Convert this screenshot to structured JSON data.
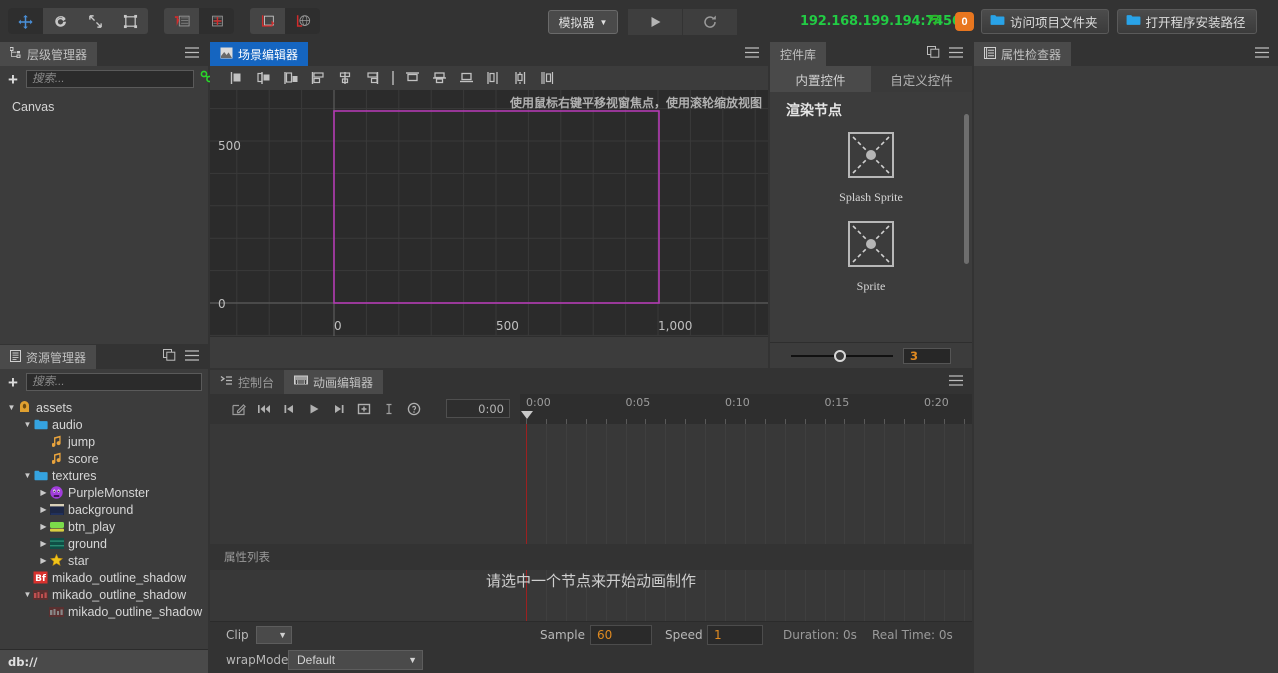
{
  "toolbar": {
    "tools": [
      {
        "name": "move-tool",
        "icon": "move-arrows",
        "selected": true
      },
      {
        "name": "rotate-tool",
        "icon": "rotate",
        "selected": false
      },
      {
        "name": "scale-tool",
        "icon": "scale",
        "selected": false
      },
      {
        "name": "rect-tool",
        "icon": "rect-transform",
        "selected": false
      }
    ],
    "pivot_tools": [
      {
        "name": "pivot-tool",
        "icon": "pivot",
        "selected": false
      },
      {
        "name": "center-tool",
        "icon": "center",
        "selected": true
      }
    ],
    "coord_tools": [
      {
        "name": "local-coord-tool",
        "icon": "local-axis",
        "selected": false
      },
      {
        "name": "global-coord-tool",
        "icon": "global-axis",
        "selected": true
      }
    ],
    "simulator_label": "模拟器",
    "play_label": "play",
    "refresh_label": "refresh",
    "ip_address": "192.168.199.194:7456",
    "wifi_icon": "wifi-icon",
    "badge_count": "0",
    "open_project_folder": "访问项目文件夹",
    "open_install_path": "打开程序安装路径"
  },
  "hierarchy": {
    "tab_title": "层级管理器",
    "tab_icon": "hierarchy-icon",
    "menu_icon": "hamburger-icon",
    "add_label": "+",
    "search_placeholder": "搜索...",
    "link_icon": "link-icon",
    "nodes": [
      {
        "label": "Canvas"
      }
    ]
  },
  "assets": {
    "tab_title": "资源管理器",
    "tab_icon": "assets-icon",
    "copy_icon": "copy-icon",
    "menu_icon": "hamburger-icon",
    "add_label": "+",
    "search_placeholder": "搜索...",
    "db_path": "db://",
    "tree": [
      {
        "label": "assets",
        "depth": 0,
        "arrow": "down",
        "icon": "assets-root",
        "icon_color": "#e0a030"
      },
      {
        "label": "audio",
        "depth": 1,
        "arrow": "down",
        "icon": "folder",
        "icon_color": "#35a3e0"
      },
      {
        "label": "jump",
        "depth": 2,
        "arrow": "none",
        "icon": "audio-note",
        "icon_color": "#e8a33d"
      },
      {
        "label": "score",
        "depth": 2,
        "arrow": "none",
        "icon": "audio-note",
        "icon_color": "#e8a33d"
      },
      {
        "label": "textures",
        "depth": 1,
        "arrow": "down",
        "icon": "folder",
        "icon_color": "#35a3e0"
      },
      {
        "label": "PurpleMonster",
        "depth": 2,
        "arrow": "right",
        "icon": "sprite-purple",
        "icon_color": "#a13ddb"
      },
      {
        "label": "background",
        "depth": 2,
        "arrow": "right",
        "icon": "sprite-bg",
        "icon_color": "#1d2745"
      },
      {
        "label": "btn_play",
        "depth": 2,
        "arrow": "right",
        "icon": "sprite-btn",
        "icon_color": "#7bdb4a"
      },
      {
        "label": "ground",
        "depth": 2,
        "arrow": "right",
        "icon": "sprite-ground",
        "icon_color": "#0f4f46"
      },
      {
        "label": "star",
        "depth": 2,
        "arrow": "right",
        "icon": "sprite-star",
        "icon_color": "#f0c419"
      },
      {
        "label": "mikado_outline_shadow",
        "depth": 1,
        "arrow": "none",
        "icon": "bitmap-font",
        "icon_color": "#d8322e"
      },
      {
        "label": "mikado_outline_shadow",
        "depth": 1,
        "arrow": "down",
        "icon": "font-atlas",
        "icon_color": "#c05050"
      },
      {
        "label": "mikado_outline_shadow",
        "depth": 2,
        "arrow": "none",
        "icon": "font-atlas",
        "icon_color": "#888888"
      }
    ]
  },
  "scene": {
    "tab_title": "场景编辑器",
    "tab_icon": "scene-icon",
    "menu_icon": "hamburger-icon",
    "align_tools": [
      "align-left",
      "align-center-h",
      "align-right",
      "align-box-left",
      "align-box-center",
      "align-box-right",
      "separator",
      "align-top",
      "align-middle",
      "align-bottom",
      "dist-h-left",
      "dist-h-center",
      "dist-h-right"
    ],
    "hint": "使用鼠标右键平移视窗焦点，使用滚轮缩放视图",
    "axis_y_labels": [
      "500",
      "0"
    ],
    "axis_x_labels": [
      "0",
      "500",
      "1,000"
    ],
    "canvas_rect_color": "#b23ab2"
  },
  "widgets": {
    "tab_title": "控件库",
    "copy_icon": "copy-icon",
    "menu_icon": "hamburger-icon",
    "tabs": [
      {
        "label": "内置控件",
        "active": true
      },
      {
        "label": "自定义控件",
        "active": false
      }
    ],
    "section_title": "渲染节点",
    "items": [
      {
        "label": "Splash Sprite",
        "icon": "sprite-placeholder-icon"
      },
      {
        "label": "Sprite",
        "icon": "sprite-placeholder-icon"
      }
    ],
    "zoom_value": "3"
  },
  "inspector": {
    "tab_title": "属性检查器",
    "tab_icon": "inspector-icon",
    "menu_icon": "hamburger-icon"
  },
  "animation": {
    "tabs": [
      {
        "label": "控制台",
        "icon": "console-icon",
        "active": false
      },
      {
        "label": "动画编辑器",
        "icon": "animation-icon",
        "active": true
      }
    ],
    "menu_icon": "hamburger-icon",
    "controls": [
      {
        "name": "edit-mode-button",
        "icon": "pencil-square-icon"
      },
      {
        "name": "jump-start-button",
        "icon": "skip-start-icon"
      },
      {
        "name": "prev-frame-button",
        "icon": "step-back-icon"
      },
      {
        "name": "play-button",
        "icon": "play-icon"
      },
      {
        "name": "next-frame-button",
        "icon": "step-forward-icon"
      },
      {
        "name": "add-keyframe-button",
        "icon": "plus-box-icon"
      },
      {
        "name": "insert-button",
        "icon": "text-cursor-icon"
      },
      {
        "name": "help-button",
        "icon": "question-circle-icon"
      }
    ],
    "current_time": "0:00",
    "ruler_ticks": [
      "0:00",
      "0:05",
      "0:10",
      "0:15",
      "0:20"
    ],
    "property_list_label": "属性列表",
    "empty_message": "请选中一个节点来开始动画制作",
    "footer": {
      "clip_label": "Clip",
      "clip_value": "",
      "sample_label": "Sample",
      "sample_value": "60",
      "speed_label": "Speed",
      "speed_value": "1",
      "duration_label": "Duration: 0s",
      "real_time_label": "Real Time: 0s",
      "wrapmode_label": "wrapMode:",
      "wrapmode_value": "Default"
    }
  }
}
